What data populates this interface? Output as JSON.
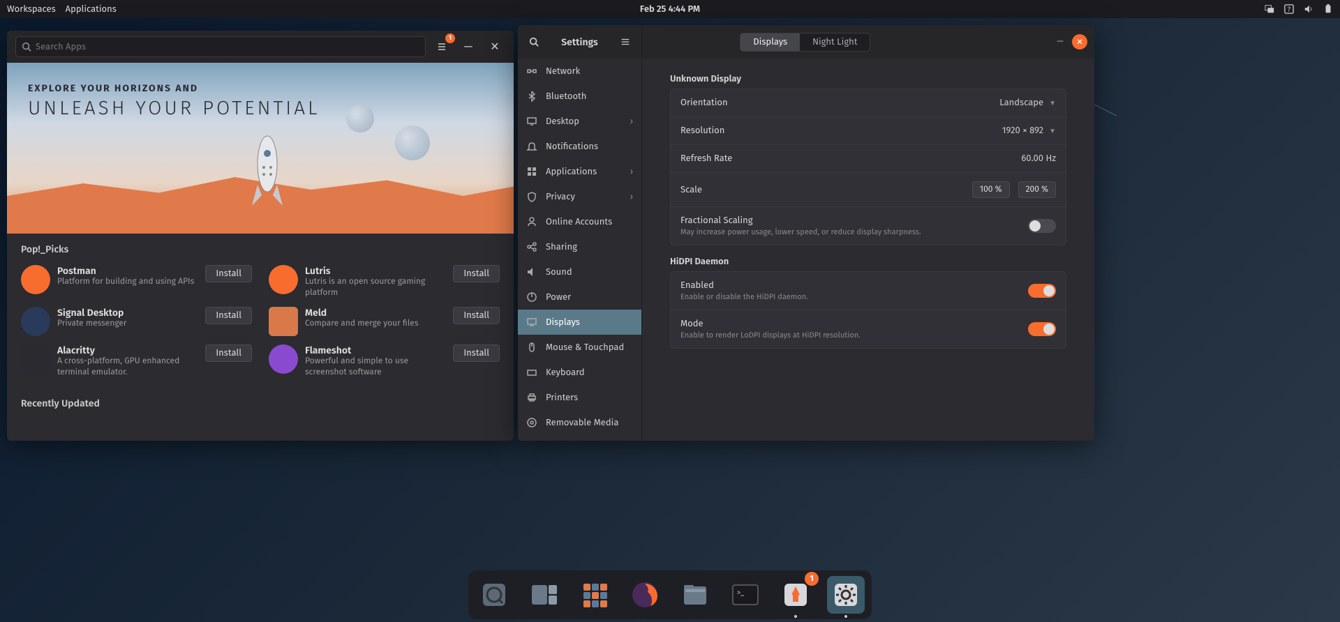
{
  "panel": {
    "workspaces": "Workspaces",
    "applications": "Applications",
    "datetime": "Feb 25  4:44 PM"
  },
  "shop": {
    "search_placeholder": "Search Apps",
    "updates_badge": "1",
    "hero_sub": "EXPLORE YOUR HORIZONS AND",
    "hero_title": "UNLEASH YOUR POTENTIAL",
    "picks_title": "Pop!_Picks",
    "install_label": "Install",
    "recently_updated": "Recently Updated",
    "picks": [
      {
        "name": "Postman",
        "desc": "Platform for building and using APIs",
        "icon_bg": "#f86c2e"
      },
      {
        "name": "Lutris",
        "desc": "Lutris is an open source gaming platform",
        "icon_bg": "#f86c2e"
      },
      {
        "name": "Signal Desktop",
        "desc": "Private messenger",
        "icon_bg": "#2a3a5a"
      },
      {
        "name": "Meld",
        "desc": "Compare and merge your files",
        "icon_bg": "#d97848"
      },
      {
        "name": "Alacritty",
        "desc": "A cross-platform, GPU enhanced terminal emulator.",
        "icon_bg": "#2a2a30"
      },
      {
        "name": "Flameshot",
        "desc": "Powerful and simple to use screenshot software",
        "icon_bg": "#8a4ad0"
      }
    ]
  },
  "settings": {
    "title": "Settings",
    "nav": [
      {
        "label": "Network",
        "icon": "wifi"
      },
      {
        "label": "Bluetooth",
        "icon": "bluetooth"
      },
      {
        "label": "Desktop",
        "icon": "desktop",
        "chev": true
      },
      {
        "label": "Notifications",
        "icon": "bell"
      },
      {
        "label": "Applications",
        "icon": "apps",
        "chev": true
      },
      {
        "label": "Privacy",
        "icon": "shield",
        "chev": true
      },
      {
        "label": "Online Accounts",
        "icon": "user"
      },
      {
        "label": "Sharing",
        "icon": "share"
      },
      {
        "label": "Sound",
        "icon": "sound"
      },
      {
        "label": "Power",
        "icon": "power"
      },
      {
        "label": "Displays",
        "icon": "display",
        "active": true
      },
      {
        "label": "Mouse & Touchpad",
        "icon": "mouse"
      },
      {
        "label": "Keyboard",
        "icon": "keyboard"
      },
      {
        "label": "Printers",
        "icon": "printer"
      },
      {
        "label": "Removable Media",
        "icon": "media"
      }
    ],
    "tabs": {
      "displays": "Displays",
      "nightlight": "Night Light"
    },
    "unknown_display": "Unknown Display",
    "orientation": {
      "label": "Orientation",
      "value": "Landscape"
    },
    "resolution": {
      "label": "Resolution",
      "value": "1920 × 892"
    },
    "refresh": {
      "label": "Refresh Rate",
      "value": "60.00 Hz"
    },
    "scale": {
      "label": "Scale",
      "opt1": "100 %",
      "opt2": "200 %"
    },
    "fractional": {
      "label": "Fractional Scaling",
      "sub": "May increase power usage, lower speed, or reduce display sharpness."
    },
    "hidpi_title": "HiDPI Daemon",
    "hidpi_enabled": {
      "label": "Enabled",
      "sub": "Enable or disable the HiDPI daemon."
    },
    "hidpi_mode": {
      "label": "Mode",
      "sub": "Enable to render LoDPI displays at HiDPI resolution."
    }
  },
  "dock": {
    "badge": "1",
    "items": [
      "shop",
      "tiling",
      "apps-grid",
      "firefox",
      "files",
      "terminal",
      "updates",
      "settings"
    ]
  }
}
